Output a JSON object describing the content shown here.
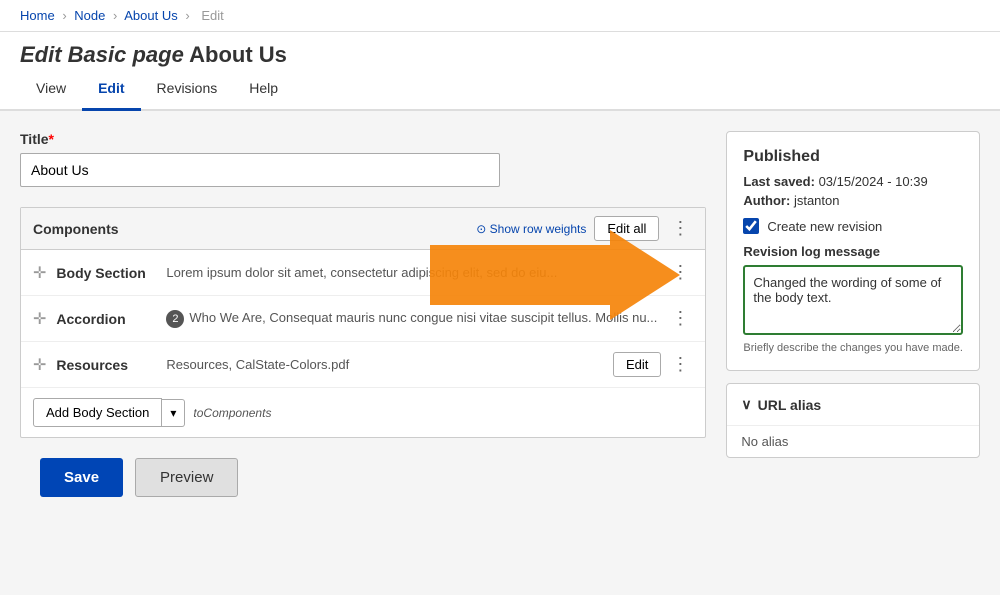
{
  "breadcrumb": {
    "home": "Home",
    "node": "Node",
    "about_us": "About Us",
    "edit": "Edit",
    "sep": "›"
  },
  "page": {
    "title_prefix": "Edit Basic page",
    "title_name": "About Us"
  },
  "tabs": [
    {
      "label": "View",
      "active": false
    },
    {
      "label": "Edit",
      "active": true
    },
    {
      "label": "Revisions",
      "active": false
    },
    {
      "label": "Help",
      "active": false
    }
  ],
  "form": {
    "title_label": "Title",
    "title_required": "*",
    "title_value": "About Us",
    "show_row_weights": "Show row weights"
  },
  "components": {
    "header": "Components",
    "edit_all": "Edit all",
    "rows": [
      {
        "name": "Body Section",
        "content": "Lorem ipsum dolor sit amet, consectetur adipiscing elit, sed do eiu...",
        "badge": null,
        "has_edit": false
      },
      {
        "name": "Accordion",
        "badge": "2",
        "content": "Who We Are, Consequat mauris nunc congue nisi vitae suscipit tellus. Mollis nu...",
        "has_edit": false
      },
      {
        "name": "Resources",
        "content": "Resources, CalState-Colors.pdf",
        "badge": null,
        "has_edit": true,
        "edit_label": "Edit"
      }
    ],
    "add_body_label": "Add Body Section",
    "add_to_label": "toComponents"
  },
  "sidebar": {
    "status": "Published",
    "last_saved_label": "Last saved:",
    "last_saved_value": "03/15/2024 - 10:39",
    "author_label": "Author:",
    "author_value": "jstanton",
    "checkbox_label": "Create new revision",
    "checkbox_checked": true,
    "revision_log_label": "Revision log message",
    "revision_text": "Changed the wording of some of the body text.",
    "revision_hint": "Briefly describe the changes you have made.",
    "url_alias_label": "URL alias",
    "url_alias_content": "No alias"
  },
  "buttons": {
    "save": "Save",
    "preview": "Preview"
  }
}
